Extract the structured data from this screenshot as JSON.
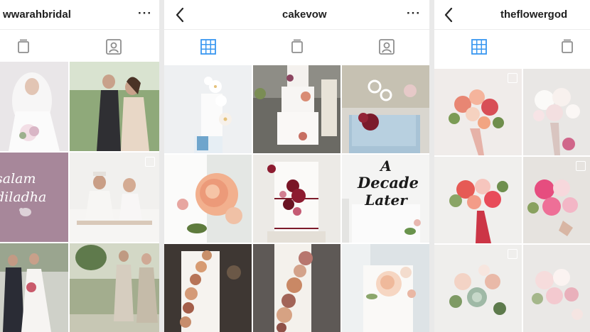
{
  "panels": [
    {
      "username": "wwarahbridal",
      "more_icon": "···",
      "icons": [
        "igtv-icon",
        "tagged-icon"
      ]
    },
    {
      "username": "cakevow",
      "more_icon": "···",
      "icons": [
        "back-icon",
        "grid-icon",
        "igtv-icon",
        "tagged-icon"
      ]
    },
    {
      "username": "theflowergod",
      "icons": [
        "back-icon",
        "grid-icon",
        "igtv-icon"
      ]
    }
  ],
  "overlay": {
    "line1": "salam",
    "line2": "diladha"
  },
  "cake_topper": {
    "line1": "A",
    "line2": "Decade",
    "line3": "Later"
  },
  "colors": {
    "accent_blue": "#3897f0",
    "icon_gray": "#8e8e8e",
    "text_dark": "#262626",
    "mauve_tile": "#a7879a"
  }
}
